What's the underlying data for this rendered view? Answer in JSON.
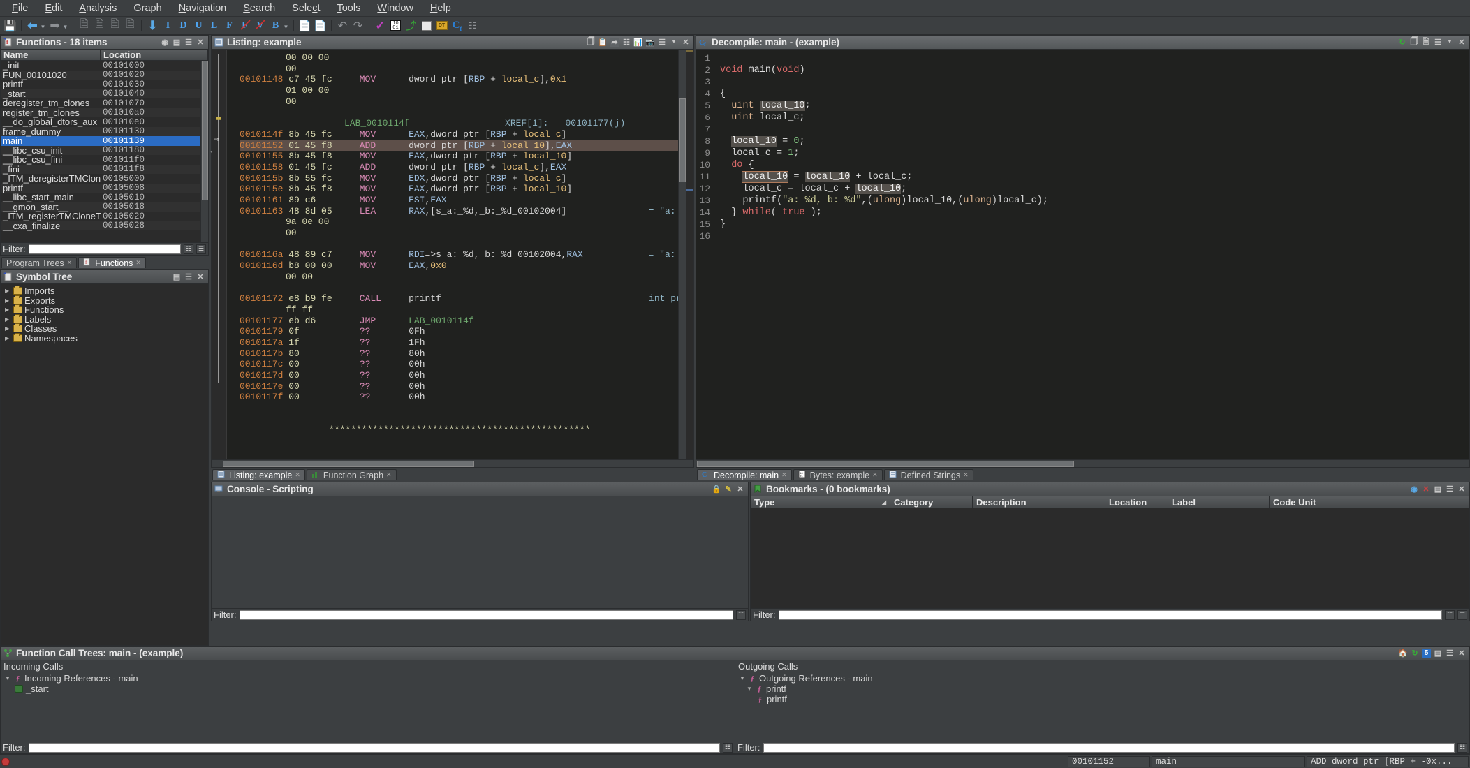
{
  "menu": {
    "items": [
      "File",
      "Edit",
      "Analysis",
      "Graph",
      "Navigation",
      "Search",
      "Select",
      "Tools",
      "Window",
      "Help"
    ]
  },
  "toolbar": {
    "letters": [
      "I",
      "D",
      "U",
      "L",
      "F",
      "F",
      "V",
      "B"
    ],
    "save_title": "Save",
    "back_title": "Back",
    "forward_title": "Forward"
  },
  "functions_window": {
    "title": "Functions - 18 items",
    "columns": [
      "Name",
      "Location"
    ],
    "rows": [
      {
        "name": "_init",
        "loc": "00101000"
      },
      {
        "name": "FUN_00101020",
        "loc": "00101020"
      },
      {
        "name": "printf",
        "loc": "00101030"
      },
      {
        "name": "_start",
        "loc": "00101040"
      },
      {
        "name": "deregister_tm_clones",
        "loc": "00101070"
      },
      {
        "name": "register_tm_clones",
        "loc": "001010a0"
      },
      {
        "name": "__do_global_dtors_aux",
        "loc": "001010e0"
      },
      {
        "name": "frame_dummy",
        "loc": "00101130"
      },
      {
        "name": "main",
        "loc": "00101139",
        "selected": true
      },
      {
        "name": "__libc_csu_init",
        "loc": "00101180"
      },
      {
        "name": "__libc_csu_fini",
        "loc": "001011f0"
      },
      {
        "name": "_fini",
        "loc": "001011f8"
      },
      {
        "name": "_ITM_deregisterTMClone...",
        "loc": "00105000"
      },
      {
        "name": "printf",
        "loc": "00105008"
      },
      {
        "name": "__libc_start_main",
        "loc": "00105010"
      },
      {
        "name": "__gmon_start__",
        "loc": "00105018"
      },
      {
        "name": "_ITM_registerTMCloneTa...",
        "loc": "00105020"
      },
      {
        "name": "__cxa_finalize",
        "loc": "00105028"
      }
    ],
    "filter_label": "Filter:",
    "filter_value": ""
  },
  "left_tabs": [
    {
      "label": "Program Trees",
      "active": false
    },
    {
      "label": "Functions",
      "active": true
    }
  ],
  "symbol_tree": {
    "title": "Symbol Tree",
    "nodes": [
      "Imports",
      "Exports",
      "Functions",
      "Labels",
      "Classes",
      "Namespaces"
    ]
  },
  "listing_window": {
    "title": "Listing:  example",
    "lines": [
      {
        "type": "bytes",
        "addr": "",
        "bytes": "00 00 00"
      },
      {
        "type": "bytes",
        "addr": "",
        "bytes": "00"
      },
      {
        "type": "instr",
        "addr": "00101148",
        "bytes": "c7 45 fc",
        "mnem": "MOV",
        "opnd": "dword ptr [RBP + local_c],0x1"
      },
      {
        "type": "bytes",
        "addr": "",
        "bytes": "01 00 00"
      },
      {
        "type": "bytes",
        "addr": "",
        "bytes": "00"
      },
      {
        "type": "blank"
      },
      {
        "type": "label",
        "label": "LAB_0010114f",
        "xref": "XREF[1]:",
        "xrefval": "00101177(j)"
      },
      {
        "type": "instr",
        "addr": "0010114f",
        "bytes": "8b 45 fc",
        "mnem": "MOV",
        "opnd": "EAX,dword ptr [RBP + local_c]"
      },
      {
        "type": "instr",
        "addr": "00101152",
        "bytes": "01 45 f8",
        "mnem": "ADD",
        "opnd": "dword ptr [RBP + local_10],EAX",
        "highlight": true
      },
      {
        "type": "instr",
        "addr": "00101155",
        "bytes": "8b 45 f8",
        "mnem": "MOV",
        "opnd": "EAX,dword ptr [RBP + local_10]"
      },
      {
        "type": "instr",
        "addr": "00101158",
        "bytes": "01 45 fc",
        "mnem": "ADD",
        "opnd": "dword ptr [RBP + local_c],EAX"
      },
      {
        "type": "instr",
        "addr": "0010115b",
        "bytes": "8b 55 fc",
        "mnem": "MOV",
        "opnd": "EDX,dword ptr [RBP + local_c]"
      },
      {
        "type": "instr",
        "addr": "0010115e",
        "bytes": "8b 45 f8",
        "mnem": "MOV",
        "opnd": "EAX,dword ptr [RBP + local_10]"
      },
      {
        "type": "instr",
        "addr": "00101161",
        "bytes": "89 c6",
        "mnem": "MOV",
        "opnd": "ESI,EAX"
      },
      {
        "type": "instr",
        "addr": "00101163",
        "bytes": "48 8d 05",
        "mnem": "LEA",
        "opnd": "RAX,[s_a:_%d,_b:_%d_00102004]",
        "cmt": "= \"a: %d, b: %d\""
      },
      {
        "type": "bytes",
        "addr": "",
        "bytes": "9a 0e 00"
      },
      {
        "type": "bytes",
        "addr": "",
        "bytes": "00"
      },
      {
        "type": "blank"
      },
      {
        "type": "instr",
        "addr": "0010116a",
        "bytes": "48 89 c7",
        "mnem": "MOV",
        "opnd": "RDI=>s_a:_%d,_b:_%d_00102004,RAX",
        "cmt": "= \"a: %d, b: %d\""
      },
      {
        "type": "instr",
        "addr": "0010116d",
        "bytes": "b8 00 00",
        "mnem": "MOV",
        "opnd": "EAX,0x0"
      },
      {
        "type": "bytes",
        "addr": "",
        "bytes": "00 00"
      },
      {
        "type": "blank"
      },
      {
        "type": "instr",
        "addr": "00101172",
        "bytes": "e8 b9 fe",
        "mnem": "CALL",
        "opnd": "printf",
        "cmt": "int printf(char * __form"
      },
      {
        "type": "bytes",
        "addr": "",
        "bytes": "ff ff"
      },
      {
        "type": "instr",
        "addr": "00101177",
        "bytes": "eb d6",
        "mnem": "JMP",
        "opnd": "LAB_0010114f"
      },
      {
        "type": "instr",
        "addr": "00101179",
        "bytes": "0f",
        "mnem": "??",
        "opnd": "0Fh"
      },
      {
        "type": "instr",
        "addr": "0010117a",
        "bytes": "1f",
        "mnem": "??",
        "opnd": "1Fh"
      },
      {
        "type": "instr",
        "addr": "0010117b",
        "bytes": "80",
        "mnem": "??",
        "opnd": "80h"
      },
      {
        "type": "instr",
        "addr": "0010117c",
        "bytes": "00",
        "mnem": "??",
        "opnd": "00h"
      },
      {
        "type": "instr",
        "addr": "0010117d",
        "bytes": "00",
        "mnem": "??",
        "opnd": "00h"
      },
      {
        "type": "instr",
        "addr": "0010117e",
        "bytes": "00",
        "mnem": "??",
        "opnd": "00h"
      },
      {
        "type": "instr",
        "addr": "0010117f",
        "bytes": "00",
        "mnem": "??",
        "opnd": "00h"
      },
      {
        "type": "blank"
      },
      {
        "type": "blank"
      },
      {
        "type": "sep",
        "text": "************************************************"
      }
    ]
  },
  "listing_tabs": [
    {
      "label": "Listing:  example",
      "active": true
    },
    {
      "label": "Function Graph",
      "active": false
    }
  ],
  "decompile_window": {
    "title": "Decompile: main -  (example)",
    "lines": [
      {
        "n": 1,
        "code": ""
      },
      {
        "n": 2,
        "code": "void main(void)"
      },
      {
        "n": 3,
        "code": ""
      },
      {
        "n": 4,
        "code": "{"
      },
      {
        "n": 5,
        "code": "  uint local_10;"
      },
      {
        "n": 6,
        "code": "  uint local_c;"
      },
      {
        "n": 7,
        "code": ""
      },
      {
        "n": 8,
        "code": "  local_10 = 0;"
      },
      {
        "n": 9,
        "code": "  local_c = 1;"
      },
      {
        "n": 10,
        "code": "  do {"
      },
      {
        "n": 11,
        "code": "    local_10 = local_10 + local_c;"
      },
      {
        "n": 12,
        "code": "    local_c = local_c + local_10;"
      },
      {
        "n": 13,
        "code": "    printf(\"a: %d, b: %d\",(ulong)local_10,(ulong)local_c);"
      },
      {
        "n": 14,
        "code": "  } while( true );"
      },
      {
        "n": 15,
        "code": "}"
      },
      {
        "n": 16,
        "code": ""
      }
    ]
  },
  "decompile_tabs": [
    {
      "label": "Decompile: main",
      "active": true
    },
    {
      "label": "Bytes: example",
      "active": false
    },
    {
      "label": "Defined Strings",
      "active": false
    }
  ],
  "console_window": {
    "title": "Console - Scripting",
    "filter_label": "Filter:",
    "filter_value": ""
  },
  "bookmarks_window": {
    "title": "Bookmarks - (0 bookmarks)",
    "columns": [
      "Type",
      "Category",
      "Description",
      "Location",
      "Label",
      "Code Unit"
    ],
    "rows": [],
    "filter_label": "Filter:",
    "filter_value": ""
  },
  "call_trees": {
    "title": "Function Call Trees: main -  (example)",
    "badge": "5",
    "incoming_label": "Incoming Calls",
    "outgoing_label": "Outgoing Calls",
    "incoming_root": "Incoming References - main",
    "incoming_child": "_start",
    "outgoing_root": "Outgoing References - main",
    "outgoing_children": [
      "printf",
      "printf"
    ],
    "filter_label": "Filter:",
    "filter_value": ""
  },
  "status_bar": {
    "address": "00101152",
    "function": "main",
    "instruction": "ADD dword ptr [RBP + -0x..."
  }
}
